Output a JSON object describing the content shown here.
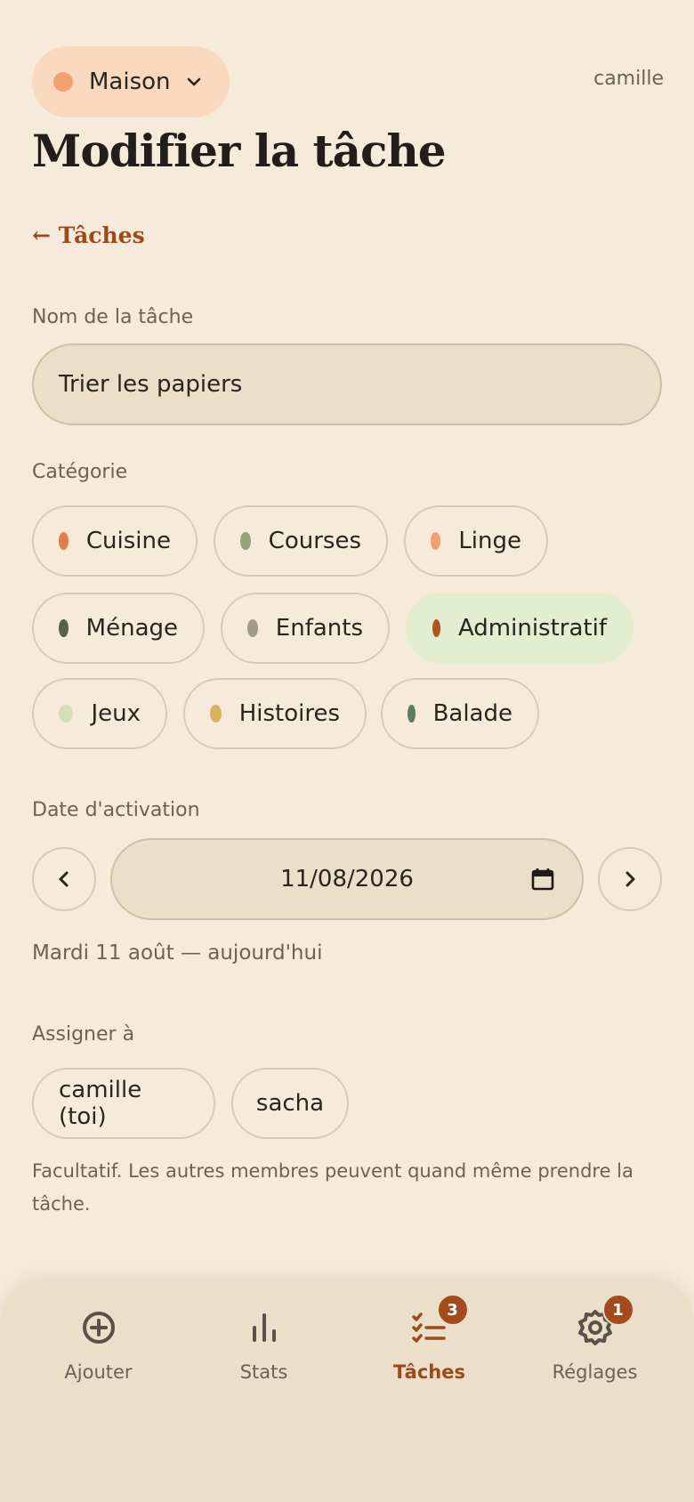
{
  "header": {
    "household_label": "Maison",
    "household_color": "#f4a06e",
    "user_name": "camille",
    "page_title": "Modifier la tâche",
    "back_link": "← Tâches"
  },
  "form": {
    "name_label": "Nom de la tâche",
    "name_value": "Trier les papiers",
    "category_label": "Catégorie",
    "categories": [
      {
        "label": "Cuisine",
        "color": "#de7f4c"
      },
      {
        "label": "Courses",
        "color": "#92a576"
      },
      {
        "label": "Linge",
        "color": "#f4a06e"
      },
      {
        "label": "Ménage",
        "color": "#556444"
      },
      {
        "label": "Enfants",
        "color": "#a39a8e"
      },
      {
        "label": "Administratif",
        "color": "#ad5624",
        "selected": true
      },
      {
        "label": "Jeux",
        "color": "#d3e0b7"
      },
      {
        "label": "Histoires",
        "color": "#d8b45e"
      },
      {
        "label": "Balade",
        "color": "#5d7c65"
      }
    ],
    "date_label": "Date d'activation",
    "date_value": "11/08/2026",
    "date_note": "Mardi 11 août — aujourd'hui",
    "assign_label": "Assigner à",
    "assignees": [
      "camille (toi)",
      "sacha"
    ],
    "help_text": "Facultatif. Les autres membres peuvent quand même prendre la tâche."
  },
  "tabbar": {
    "tabs": [
      {
        "label": "Ajouter",
        "icon": "plus-circle-icon"
      },
      {
        "label": "Stats",
        "icon": "bar-chart-icon"
      },
      {
        "label": "Tâches",
        "icon": "checklist-icon",
        "badge": "3",
        "active": true
      },
      {
        "label": "Réglages",
        "icon": "gear-icon",
        "badge": "1"
      }
    ]
  }
}
